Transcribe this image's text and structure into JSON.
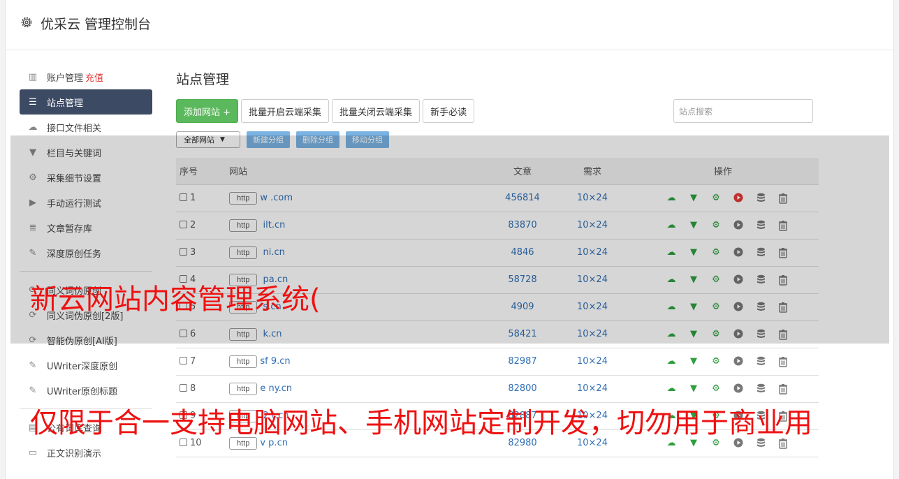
{
  "app": {
    "title": "优采云 管理控制台",
    "icon": "gear-icon"
  },
  "sidebar": {
    "items": [
      {
        "label": "账户管理",
        "badge": "充值",
        "icon": "bar-chart-icon"
      },
      {
        "label": "站点管理",
        "icon": "server-icon",
        "active": true
      },
      {
        "label": "接口文件相关",
        "icon": "cloud-upload-icon"
      },
      {
        "label": "栏目与关键词",
        "icon": "filter-icon"
      },
      {
        "label": "采集细节设置",
        "icon": "cogs-icon"
      },
      {
        "label": "手动运行测试",
        "icon": "play-circle-icon"
      },
      {
        "label": "文章暂存库",
        "icon": "database-icon"
      },
      {
        "label": "深度原创任务",
        "icon": "edit-icon"
      },
      {
        "label": "同义词伪原创",
        "icon": "refresh-icon"
      },
      {
        "label": "同义词伪原创[2版]",
        "icon": "refresh-icon"
      },
      {
        "label": "智能伪原创[AI版]",
        "icon": "refresh-icon"
      },
      {
        "label": "UWriter深度原创",
        "icon": "edit-icon"
      },
      {
        "label": "UWriter原创标题",
        "icon": "edit-icon"
      },
      {
        "label": "公有词库查询",
        "icon": "book-icon"
      },
      {
        "label": "正文识别演示",
        "icon": "monitor-icon"
      }
    ]
  },
  "main": {
    "title": "站点管理",
    "toolbar": {
      "add_site": "添加网站 +",
      "batch_open": "批量开启云端采集",
      "batch_close": "批量关闭云端采集",
      "newbie": "新手必读"
    },
    "search": {
      "placeholder": "站点搜索"
    },
    "group_select": "全部网站",
    "group_buttons": {
      "new": "新建分组",
      "delete": "删除分组",
      "move": "移动分组"
    },
    "table": {
      "headers": {
        "num": "序号",
        "site": "网站",
        "articles": "文章",
        "demand": "需求",
        "ops": "操作"
      },
      "http_label": "http",
      "rows": [
        {
          "num": "1",
          "site": "w           .com",
          "articles": "456814",
          "demand": "10×24",
          "run_active": true
        },
        {
          "num": "2",
          "site": "      ilt.cn",
          "articles": "83870",
          "demand": "10×24"
        },
        {
          "num": "3",
          "site": "      ni.cn",
          "articles": "4846",
          "demand": "10×24"
        },
        {
          "num": "4",
          "site": "        pa.cn",
          "articles": "58728",
          "demand": "10×24"
        },
        {
          "num": "5",
          "site": "        s.cn",
          "articles": "4909",
          "demand": "10×24"
        },
        {
          "num": "6",
          "site": "      k.cn",
          "articles": "58421",
          "demand": "10×24"
        },
        {
          "num": "7",
          "site": "sf  9.cn",
          "articles": "82987",
          "demand": "10×24"
        },
        {
          "num": "8",
          "site": "e    ny.cn",
          "articles": "82800",
          "demand": "10×24"
        },
        {
          "num": "9",
          "site": "    2    t.cn",
          "articles": "82887",
          "demand": "10×24"
        },
        {
          "num": "10",
          "site": "v     p.cn",
          "articles": "82980",
          "demand": "10×24"
        }
      ]
    }
  },
  "watermark": {
    "line1": "新云网站内容管理系统(",
    "line2": "仅限于合一支持电脑网站、手机网站定制开发，切勿用于商业用"
  },
  "colors": {
    "accent_green": "#5cb85c",
    "sidebar_active": "#3d4a63",
    "link": "#2f6fb5",
    "watermark": "#ee1111"
  }
}
